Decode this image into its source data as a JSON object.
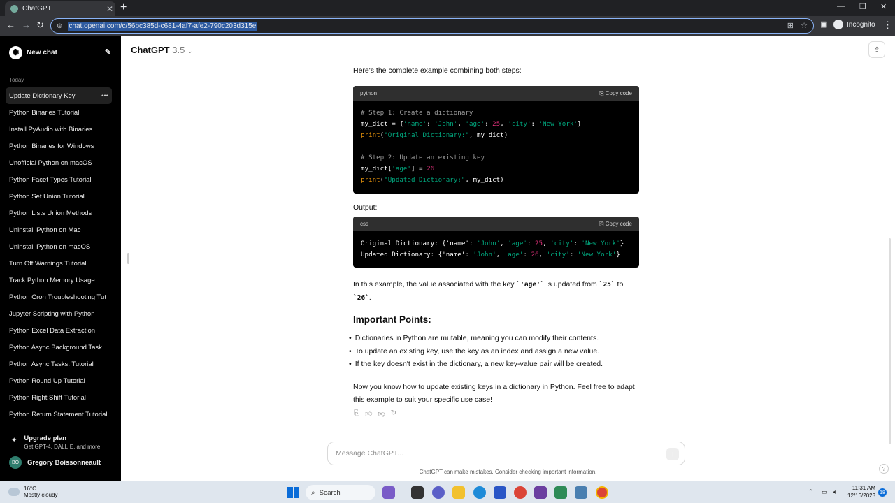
{
  "browser": {
    "tab_title": "ChatGPT",
    "tab_close": "✕",
    "new_tab": "+",
    "url": "chat.openai.com/c/56bc385d-c681-4af7-afe2-790c203d315e",
    "profile_label": "Incognito"
  },
  "sidebar": {
    "new_chat": "New chat",
    "section_today": "Today",
    "items": [
      {
        "label": "Update Dictionary Key"
      },
      {
        "label": "Python Binaries Tutorial"
      },
      {
        "label": "Install PyAudio with Binaries"
      },
      {
        "label": "Python Binaries for Windows"
      },
      {
        "label": "Unofficial Python on macOS"
      },
      {
        "label": "Python Facet Types Tutorial"
      },
      {
        "label": "Python Set Union Tutorial"
      },
      {
        "label": "Python Lists Union Methods"
      },
      {
        "label": "Uninstall Python on Mac"
      },
      {
        "label": "Uninstall Python on macOS"
      },
      {
        "label": "Turn Off Warnings Tutorial"
      },
      {
        "label": "Track Python Memory Usage"
      },
      {
        "label": "Python Cron Troubleshooting Tut"
      },
      {
        "label": "Jupyter Scripting with Python"
      },
      {
        "label": "Python Excel Data Extraction"
      },
      {
        "label": "Python Async Background Task"
      },
      {
        "label": "Python Async Tasks: Tutorial"
      },
      {
        "label": "Python Round Up Tutorial"
      },
      {
        "label": "Python Right Shift Tutorial"
      },
      {
        "label": "Python Return Statement Tutorial"
      }
    ],
    "upgrade_title": "Upgrade plan",
    "upgrade_sub": "Get GPT-4, DALL·E, and more",
    "user_initials": "BO",
    "user_name": "Gregory Boissonneault"
  },
  "main": {
    "model_name": "ChatGPT",
    "model_version": "3.5",
    "intro": "Here's the complete example combining both steps:",
    "code1_lang": "python",
    "copy_code": "Copy code",
    "code1": {
      "l1": "# Step 1: Create a dictionary",
      "l2_a": "my_dict = {",
      "l2_k1": "'name'",
      "l2_s1": ": ",
      "l2_v1": "'John'",
      "l2_s2": ", ",
      "l2_k2": "'age'",
      "l2_s3": ": ",
      "l2_v2": "25",
      "l2_s4": ", ",
      "l2_k3": "'city'",
      "l2_s5": ": ",
      "l2_v3": "'New York'",
      "l2_e": "}",
      "l3_fn": "print",
      "l3_a": "(",
      "l3_str": "\"Original Dictionary:\"",
      "l3_b": ", my_dict)",
      "l4": "# Step 2: Update an existing key",
      "l5_a": "my_dict[",
      "l5_k": "'age'",
      "l5_b": "] = ",
      "l5_v": "26",
      "l6_fn": "print",
      "l6_a": "(",
      "l6_str": "\"Updated Dictionary:\"",
      "l6_b": ", my_dict)"
    },
    "output_label": "Output:",
    "code2_lang": "css",
    "code2": {
      "l1_a": "Original Dictionary: {'name': ",
      "l1_v1": "'John'",
      "l1_b": ", ",
      "l1_k2": "'age'",
      "l1_c": ": ",
      "l1_v2": "25",
      "l1_d": ", ",
      "l1_k3": "'city'",
      "l1_e": ": ",
      "l1_v3": "'New York'",
      "l1_f": "}",
      "l2_a": "Updated Dictionary: {'name': ",
      "l2_v1": "'John'",
      "l2_b": ", ",
      "l2_k2": "'age'",
      "l2_c": ": ",
      "l2_v2": "26",
      "l2_d": ", ",
      "l2_k3": "'city'",
      "l2_e": ": ",
      "l2_v3": "'New York'",
      "l2_f": "}"
    },
    "explain_1": "In this example, the value associated with the key ",
    "explain_key": "`'age'`",
    "explain_2": " is updated from ",
    "explain_from": "`25`",
    "explain_3": " to",
    "explain_to": "`26`",
    "explain_4": ".",
    "heading": "Important Points:",
    "bullets": [
      "Dictionaries in Python are mutable, meaning you can modify their contents.",
      "To update an existing key, use the key as an index and assign a new value.",
      "If the key doesn't exist in the dictionary, a new key-value pair will be created."
    ],
    "closing_1": "Now you know how to update existing keys in a dictionary in Python. Feel free to adapt",
    "closing_2": "this example to suit your specific use case!",
    "message_placeholder": "Message ChatGPT...",
    "disclaimer": "ChatGPT can make mistakes. Consider checking important information.",
    "help": "?"
  },
  "taskbar": {
    "temperature": "16°C",
    "weather": "Mostly cloudy",
    "search": "Search",
    "time": "11:31 AM",
    "date": "12/16/2023",
    "notifications": "18"
  },
  "icons": {
    "back": "back-arrow-icon",
    "forward": "forward-arrow-icon",
    "reload": "reload-icon"
  }
}
